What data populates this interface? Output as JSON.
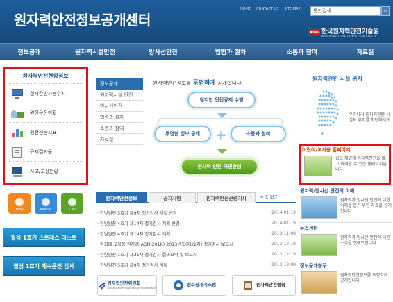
{
  "header": {
    "site_title": "원자력안전정보공개센터",
    "util_links": [
      "HOME",
      "CONTACT US",
      "SITE MAP"
    ],
    "search_value": "통합검색",
    "logo_mark": "KINS",
    "logo_name": "한국원자력안전기술원",
    "logo_eng": "KOREA INSTITUTE OF NUCLEAR SAFETY"
  },
  "nav": [
    "정보공개",
    "원자력시설안전",
    "방사선안전",
    "법령과 절차",
    "소통과 참여",
    "자료실"
  ],
  "left": {
    "title": "원자력안전현황정보",
    "items": [
      "실시간방사능수치",
      "원전운전현황",
      "원전성능지표",
      "규제결과물",
      "사고/고장현황"
    ]
  },
  "social": [
    "Blog",
    "Mobile",
    "Call"
  ],
  "left_banners": [
    "월성 1호기 스트레스 테스트",
    "월성 1호기 계속운전 심사"
  ],
  "intro": {
    "tabs": [
      "정보공개",
      "원자력시설 안전",
      "방사선안전",
      "법령과 절차",
      "소통과 참여",
      "자료실"
    ],
    "heading_pre": "원자력안전정보를 ",
    "heading_hl": "투명하게",
    "heading_post": " 공개합니다.",
    "diagram": [
      "철저한 안전규제 수행",
      "투명한 정보 공개",
      "소통과 참여",
      "원자력 안전 국민안심"
    ]
  },
  "news": {
    "tabs": [
      "원자력안전정보",
      "공지사항",
      "원자력안전관련기사"
    ],
    "more": "+ 더보기",
    "rows": [
      {
        "title": "· 한빛원전 5호기 제9차 정기검사 계획 변경",
        "date": "2014-01-19"
      },
      {
        "title": "· 한빛원전 4호기 제14차 정기검사 계획 변경",
        "date": "2014-01-19"
      },
      {
        "title": "· 한빛원전 4호기 제14차 정기검사 계획",
        "date": "2013-11-08"
      },
      {
        "title": "· 경희대 교육용 원자로(AGN-201K) 2013년도(제22차) 정기검사 보고서",
        "date": "2013-12-19"
      },
      {
        "title": "· 한빛원전 1호기 제21차 정기검사 결과요약 및 보고서",
        "date": "2013-12-19"
      },
      {
        "title": "· 한빛원전 5호기 제9차 정기검사 계획",
        "date": "2013-12-09"
      }
    ]
  },
  "footer": {
    "b1_title": "원자력안전위원회",
    "b1_sub": "NUCLEAR SAFETY AND SECURITY COMMISSION",
    "b2_title": "정보공개시스템",
    "b3_title": "원자력안전법령"
  },
  "right": {
    "facility_title": "원자력관련 시설 위치",
    "map_text": "우리나라 원자력관련 시설의 위치를 확인하세요",
    "kids_title": "어린이/교사용 홈페이지",
    "kids_text": "쉽고 재밌게 원자력안전을 알고 이해할 수 있는 홈페이지입니다.",
    "s2_title": "원자력/방사선 안전의 이해",
    "s2_text": "원자력과 방사선 안전에 대한 이해를 돕기 위한 자료를 공개합니다.",
    "s3_title": "뉴스센터",
    "s3_text": "원자력과 방사선 안전에 대한 소식을 전해드립니다.",
    "s4_title": "정보공개청구",
    "s4_text": "원자력안전정보를 투명하게 공개합니다."
  },
  "colors": {
    "header": "#1e5e9c",
    "highlight": "#e0101a",
    "accent": "#2a6eb0",
    "green": "#5aa42a"
  }
}
